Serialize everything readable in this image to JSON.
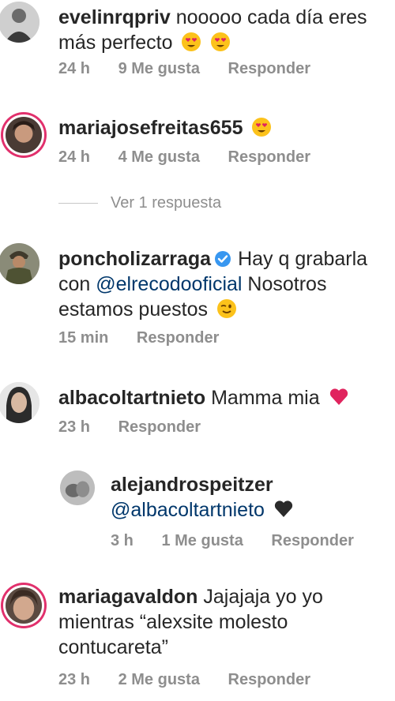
{
  "comments": [
    {
      "username": "evelinrqpriv",
      "text": "nooooo cada día eres más perfecto",
      "emojis": [
        "heart-eyes-emoji",
        "heart-eyes-emoji"
      ],
      "time": "24 h",
      "likes": "9 Me gusta",
      "reply": "Responder"
    },
    {
      "username": "mariajosefreitas655",
      "text": "",
      "emojis": [
        "heart-eyes-emoji"
      ],
      "time": "24 h",
      "likes": "4 Me gusta",
      "reply": "Responder",
      "view_replies": "Ver 1 respuesta"
    },
    {
      "username": "poncholizarraga",
      "verified": true,
      "text_line1": "Hay q grabarla",
      "text_mention": "@elrecodooficial",
      "text_line2": "Nosotros",
      "text_line3": "estamos puestos",
      "emojis": [
        "wink-emoji"
      ],
      "time": "15 min",
      "reply": "Responder"
    },
    {
      "username": "albacoltartnieto",
      "text": "Mamma mia",
      "emojis": [
        "red-heart-emoji"
      ],
      "time": "23 h",
      "reply": "Responder"
    },
    {
      "username": "alejandrospeitzer",
      "mention": "@albacoltartnieto",
      "emojis": [
        "black-heart-emoji"
      ],
      "time": "3 h",
      "likes": "1 Me gusta",
      "reply": "Responder"
    },
    {
      "username": "mariagavaldon",
      "text_line1": "Jajajaja yo yo",
      "text_line2": "mientras “alexsite molesto",
      "text_line3": "contucareta”",
      "time": "23 h",
      "likes": "2 Me gusta",
      "reply": "Responder"
    }
  ],
  "colors": {
    "text": "#262626",
    "meta": "#8e8e8e",
    "mention": "#00376b",
    "story_ring": "#e1306c",
    "verified": "#3897f0"
  }
}
